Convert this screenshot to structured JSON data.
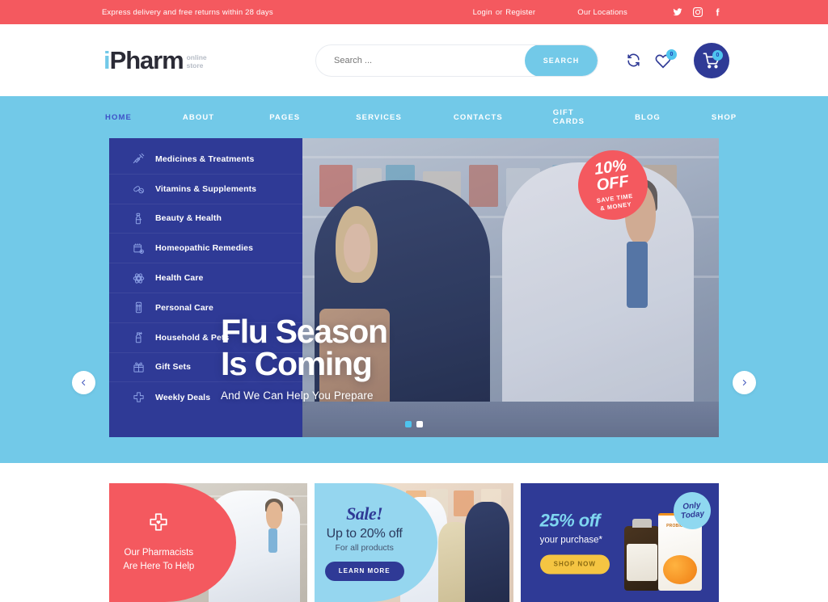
{
  "topbar": {
    "message": "Express delivery and free returns within 28 days",
    "login": "Login",
    "or": "or",
    "register": "Register",
    "locations": "Our Locations",
    "social": [
      "twitter-icon",
      "instagram-icon",
      "facebook-icon"
    ]
  },
  "header": {
    "logo_i": "i",
    "logo_main": "Pharm",
    "logo_sub_line1": "online",
    "logo_sub_line2": "store",
    "search_placeholder": "Search ...",
    "search_value": "",
    "search_button": "SEARCH",
    "compare_icon": "compare-icon",
    "wishlist_icon": "heart-icon",
    "wishlist_count": "0",
    "cart_icon": "cart-icon",
    "cart_count": "0"
  },
  "nav": {
    "items": [
      {
        "label": "HOME",
        "active": true
      },
      {
        "label": "ABOUT",
        "active": false
      },
      {
        "label": "PAGES",
        "active": false
      },
      {
        "label": "SERVICES",
        "active": false
      },
      {
        "label": "CONTACTS",
        "active": false
      },
      {
        "label": "GIFT CARDS",
        "active": false
      },
      {
        "label": "BLOG",
        "active": false
      },
      {
        "label": "SHOP",
        "active": false
      }
    ]
  },
  "categories": {
    "items": [
      {
        "label": "Medicines & Treatments",
        "icon": "syringe-icon"
      },
      {
        "label": "Vitamins & Supplements",
        "icon": "capsules-icon"
      },
      {
        "label": "Beauty & Health",
        "icon": "lotion-bottle-icon"
      },
      {
        "label": "Homeopathic Remedies",
        "icon": "medicine-box-icon"
      },
      {
        "label": "Health Care",
        "icon": "molecule-icon"
      },
      {
        "label": "Personal Care",
        "icon": "toothbrush-icon"
      },
      {
        "label": "Household & Pets",
        "icon": "spray-bottle-icon"
      },
      {
        "label": "Gift Sets",
        "icon": "gift-icon"
      },
      {
        "label": "Weekly Deals",
        "icon": "medical-cross-icon"
      }
    ]
  },
  "hero": {
    "title_line1": "Flu Season",
    "title_line2": "Is Coming",
    "subtitle": "And We Can Help You Prepare",
    "discount_line1": "10%",
    "discount_line2": "OFF",
    "discount_line3": "SAVE TIME\n& MONEY",
    "discount_sub1": "SAVE TIME",
    "discount_sub2": "& MONEY",
    "prev_icon": "chevron-left-icon",
    "next_icon": "chevron-right-icon",
    "dots": [
      {
        "active": true
      },
      {
        "active": false
      }
    ]
  },
  "promos": [
    {
      "icon": "medical-cross-heart-icon",
      "line1": "Our Pharmacists",
      "line2": "Are Here To Help"
    },
    {
      "title": "Sale!",
      "line1": "Up to 20% off",
      "line2": "For all products",
      "button": "LEARN MORE"
    },
    {
      "title": "25% off",
      "line1": "your purchase*",
      "button": "SHOP NOW",
      "badge_line1": "Only",
      "badge_line2": "Today",
      "product_label": "PROBIOTICS"
    }
  ],
  "colors": {
    "coral": "#f4595f",
    "light_blue": "#72c9e8",
    "dark_blue": "#2f3a96",
    "accent_cyan": "#4ec4ee",
    "yellow": "#f5c542"
  }
}
